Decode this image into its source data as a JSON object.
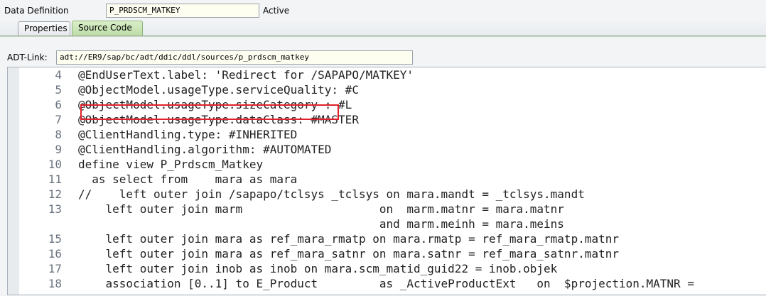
{
  "header": {
    "label": "Data Definition",
    "name_value": "P_PRDSCM_MATKEY",
    "status": "Active"
  },
  "tabs": [
    {
      "label": "Properties",
      "active": false
    },
    {
      "label": "Source Code",
      "active": true
    }
  ],
  "adt": {
    "label": "ADT-Link:",
    "value": "adt://ER9/sap/bc/adt/ddic/ddl/sources/p_prdscm_matkey"
  },
  "editor": {
    "lines": [
      {
        "num": "4",
        "text": "@EndUserText.label: 'Redirect for /SAPAPO/MATKEY'"
      },
      {
        "num": "5",
        "text": "@ObjectModel.usageType.serviceQuality: #C"
      },
      {
        "num": "6",
        "text": "@ObjectModel.usageType.sizeCategory : #L"
      },
      {
        "num": "7",
        "text": "@ObjectModel.usageType.dataClass: #MASTER"
      },
      {
        "num": "8",
        "text": "@ClientHandling.type: #INHERITED"
      },
      {
        "num": "9",
        "text": "@ClientHandling.algorithm: #AUTOMATED"
      },
      {
        "num": "10",
        "text": "define view P_Prdscm_Matkey"
      },
      {
        "num": "11",
        "text": "  as select from    mara as mara"
      },
      {
        "num": "12",
        "text": "//    left outer join /sapapo/tclsys _tclsys on mara.mandt = _tclsys.mandt"
      },
      {
        "num": "13",
        "text": "    left outer join marm                    on  marm.matnr = mara.matnr"
      },
      {
        "num": "",
        "text": "                                            and marm.meinh = mara.meins"
      },
      {
        "num": "15",
        "text": "    left outer join mara as ref_mara_rmatp on mara.rmatp = ref_mara_rmatp.matnr"
      },
      {
        "num": "16",
        "text": "    left outer join mara as ref_mara_satnr on mara.satnr = ref_mara_satnr.matnr"
      },
      {
        "num": "17",
        "text": "    left outer join inob as inob on mara.scm_matid_guid22 = inob.objek"
      },
      {
        "num": "18",
        "text": "    association [0..1] to E_Product         as _ActiveProductExt   on  $projection.MATNR ="
      }
    ]
  },
  "colors": {
    "highlight_box": "#e0202a",
    "active_tab": "#c8e3b4"
  }
}
